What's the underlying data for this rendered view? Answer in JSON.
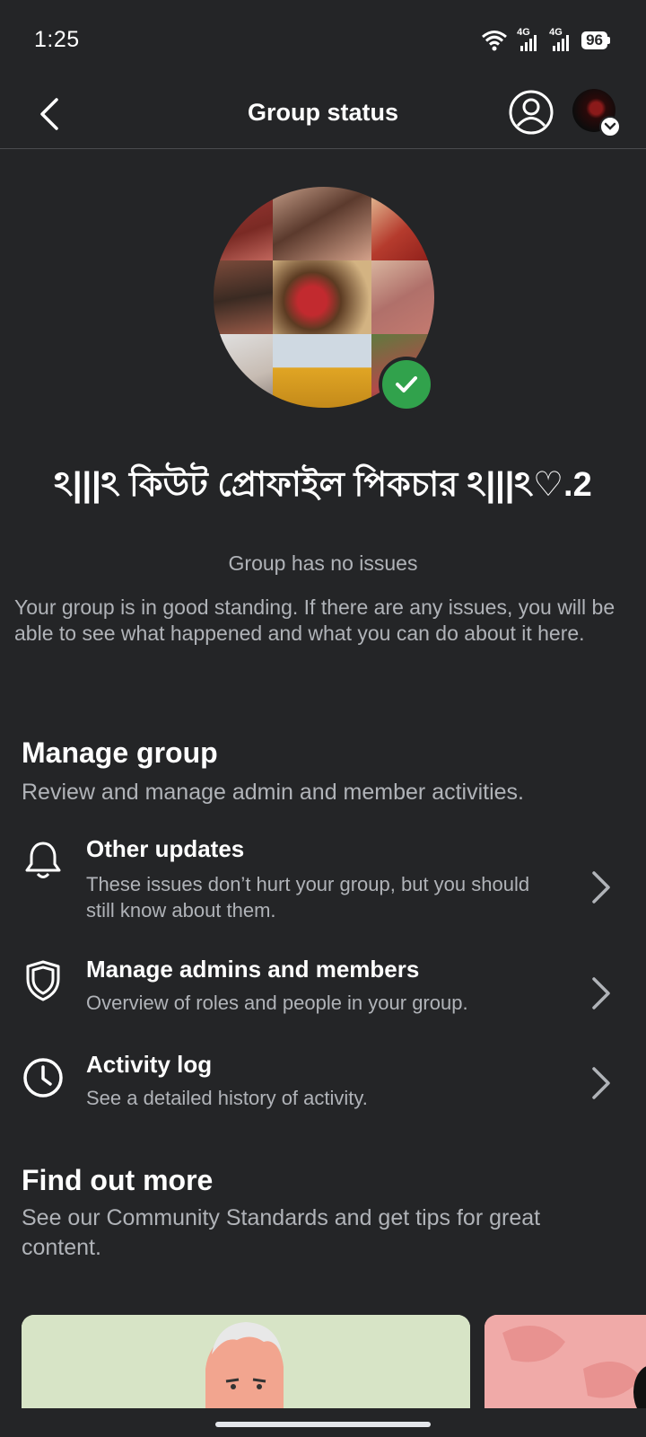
{
  "status_bar": {
    "time": "1:25",
    "network_1": "4G",
    "network_2": "4G",
    "battery": "96"
  },
  "header": {
    "title": "Group status"
  },
  "group": {
    "name": "ঽ|||ঽ কিউট প্রোফাইল পিকচার ঽ|||ঽ♡.2",
    "status_label": "Group has no issues",
    "status_description": "Your group is in good standing. If there are any issues, you will be able to see what happened and what you can do about it here."
  },
  "manage_group": {
    "title": "Manage group",
    "subtitle": "Review and manage admin and member activities.",
    "items": [
      {
        "title": "Other updates",
        "description": "These issues don’t hurt your group, but you should still know about them.",
        "icon": "bell-icon"
      },
      {
        "title": "Manage admins and members",
        "description": "Overview of roles and people in your group.",
        "icon": "shield-icon"
      },
      {
        "title": "Activity log",
        "description": "See a detailed history of activity.",
        "icon": "clock-icon"
      }
    ]
  },
  "find_out_more": {
    "title": "Find out more",
    "subtitle": "See our Community Standards and get tips for great content."
  },
  "colors": {
    "background": "#242527",
    "verified_green": "#31a24c",
    "secondary_text": "#b0b3b8"
  }
}
